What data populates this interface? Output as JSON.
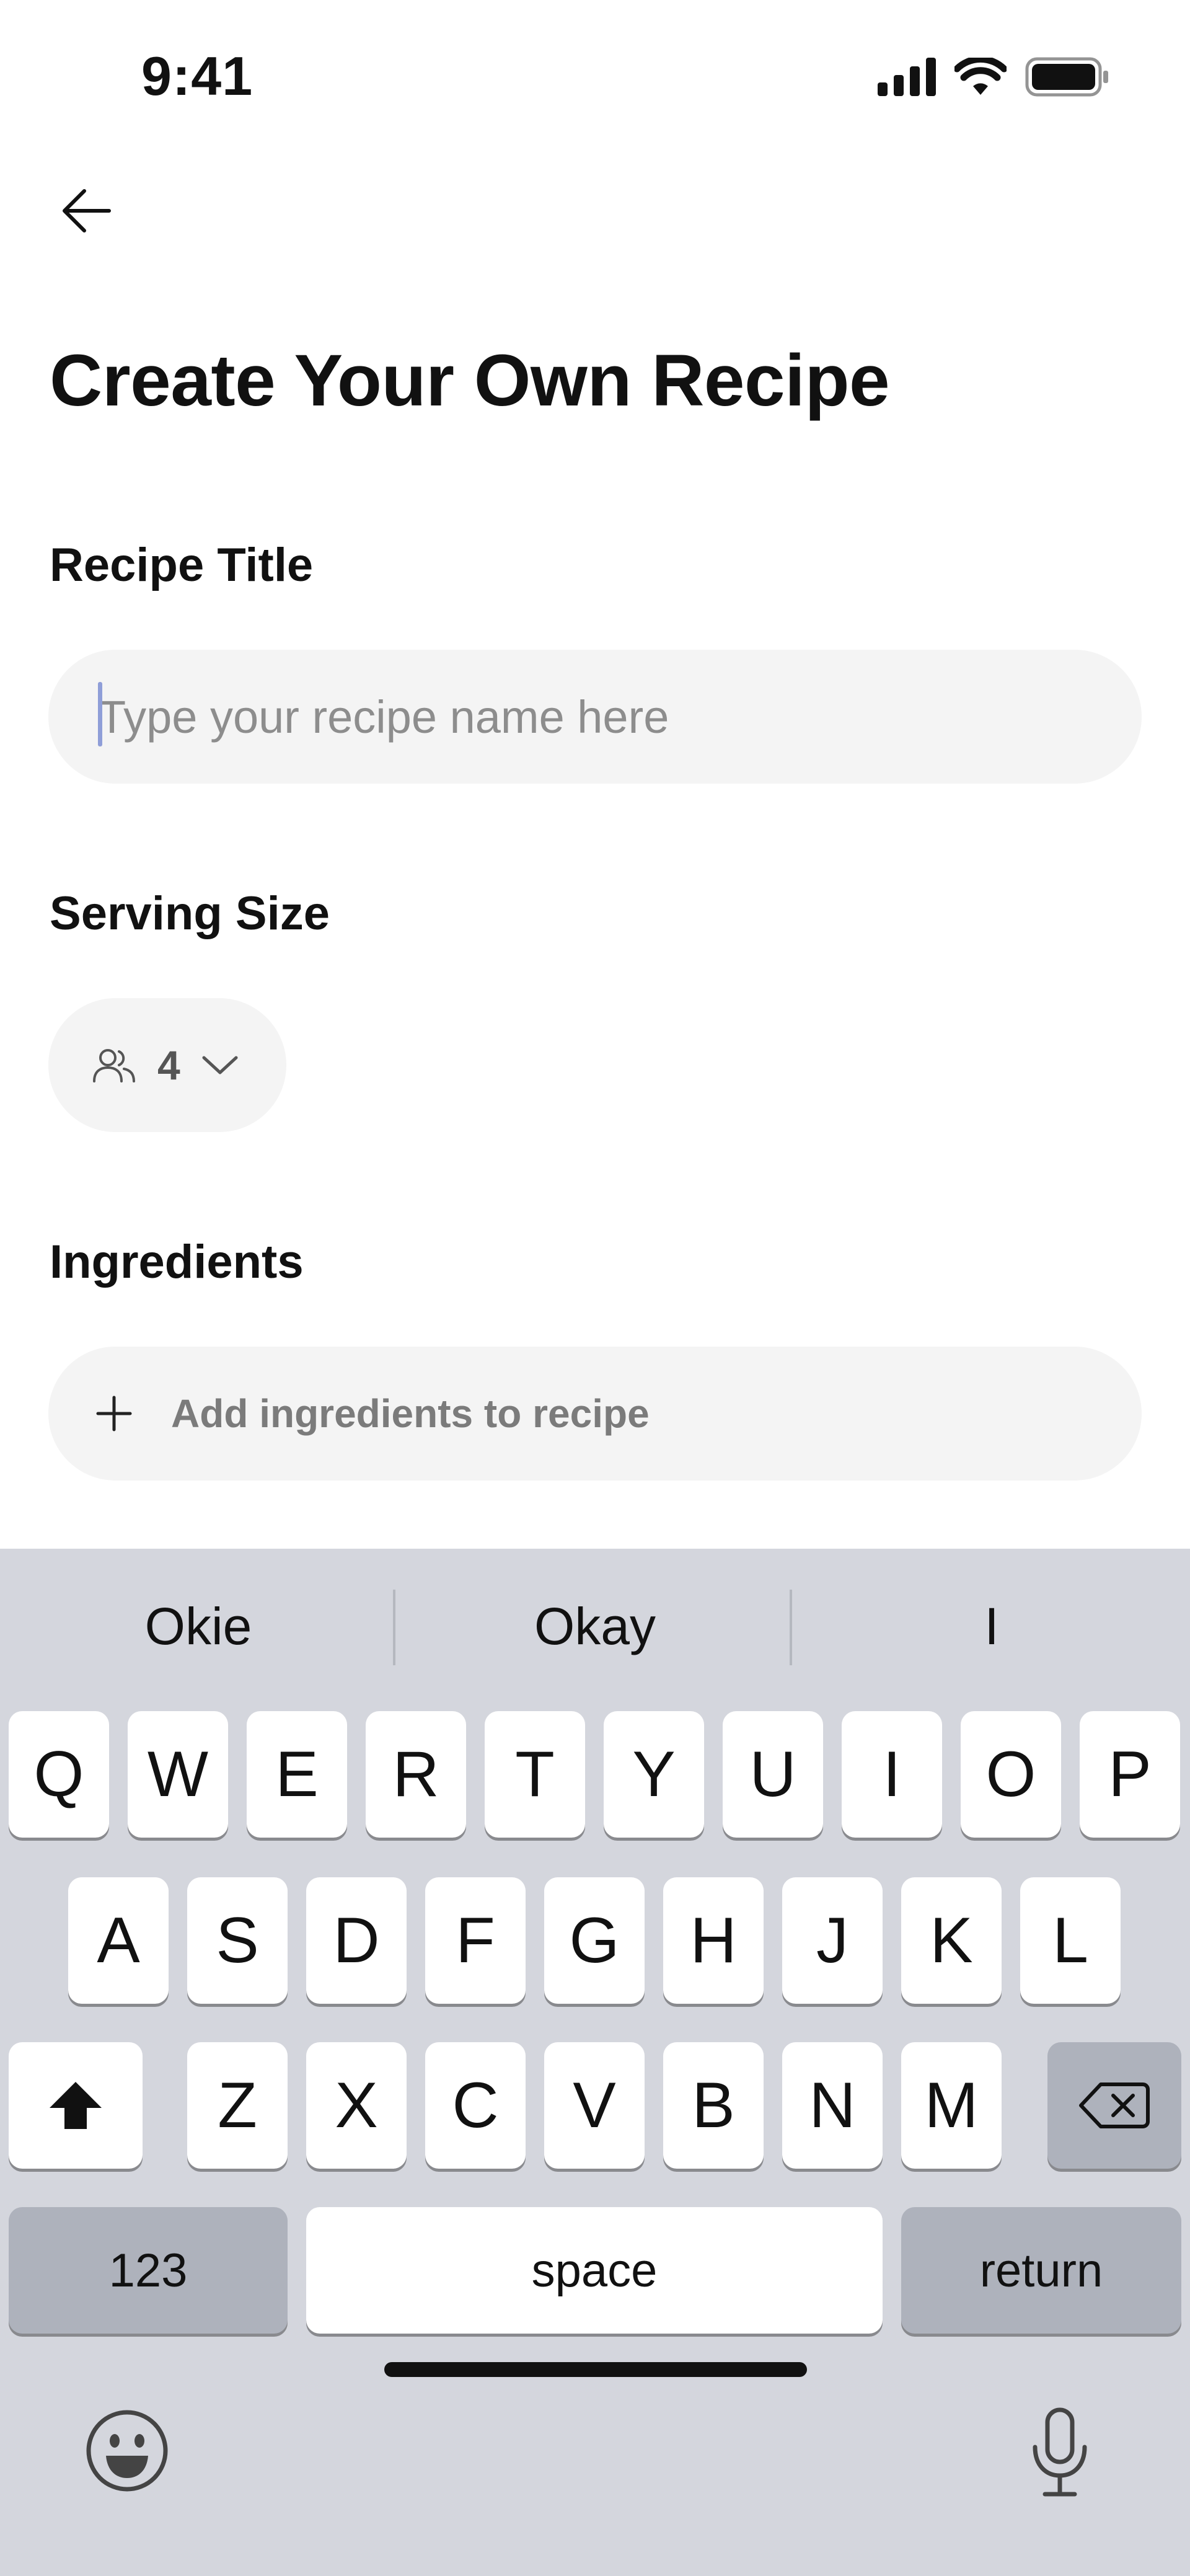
{
  "status_bar": {
    "time": "9:41"
  },
  "header": {
    "title": "Create Your Own Recipe"
  },
  "form": {
    "recipe_title": {
      "label": "Recipe Title",
      "placeholder": "Type your recipe name here",
      "value": ""
    },
    "serving_size": {
      "label": "Serving Size",
      "value": "4"
    },
    "ingredients": {
      "label": "Ingredients",
      "add_label": "Add ingredients to recipe"
    }
  },
  "keyboard": {
    "suggestions": [
      "Okie",
      "Okay",
      "I"
    ],
    "row1": [
      "Q",
      "W",
      "E",
      "R",
      "T",
      "Y",
      "U",
      "I",
      "O",
      "P"
    ],
    "row2": [
      "A",
      "S",
      "D",
      "F",
      "G",
      "H",
      "J",
      "K",
      "L"
    ],
    "row3": [
      "Z",
      "X",
      "C",
      "V",
      "B",
      "N",
      "M"
    ],
    "numbers_label": "123",
    "space_label": "space",
    "return_label": "return"
  },
  "icons": {
    "back": "arrow-left-icon",
    "people": "people-icon",
    "chevron": "chevron-down-icon",
    "plus": "plus-icon",
    "shift": "shift-icon",
    "backspace": "backspace-icon",
    "emoji": "emoji-icon",
    "microphone": "microphone-icon"
  }
}
